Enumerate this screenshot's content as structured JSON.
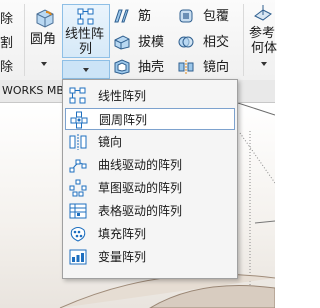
{
  "ribbon": {
    "left_partial": [
      "除",
      "割",
      "除"
    ],
    "fillet": "圆角",
    "linear_pattern": [
      "线性阵",
      "列"
    ],
    "rib": "筋",
    "draft": "拔模",
    "shell": "抽壳",
    "wrap": "包覆",
    "intersect": "相交",
    "mirror": "镜向",
    "reference": [
      "参考",
      "何体"
    ]
  },
  "tabbar": {
    "tab": "WORKS MBD"
  },
  "pattern_menu": {
    "items": [
      {
        "label": "线性阵列",
        "icon": "linear-pattern-icon"
      },
      {
        "label": "圆周阵列",
        "icon": "circular-pattern-icon",
        "highlighted": true
      },
      {
        "label": "镜向",
        "icon": "mirror-icon"
      },
      {
        "label": "曲线驱动的阵列",
        "icon": "curve-driven-pattern-icon"
      },
      {
        "label": "草图驱动的阵列",
        "icon": "sketch-driven-pattern-icon"
      },
      {
        "label": "表格驱动的阵列",
        "icon": "table-driven-pattern-icon"
      },
      {
        "label": "填充阵列",
        "icon": "fill-pattern-icon"
      },
      {
        "label": "变量阵列",
        "icon": "variable-pattern-icon"
      }
    ]
  },
  "colors": {
    "accent": "#1e6fbf",
    "highlight_border": "#7da2ce",
    "menu_bg": "#f5f5f5"
  }
}
